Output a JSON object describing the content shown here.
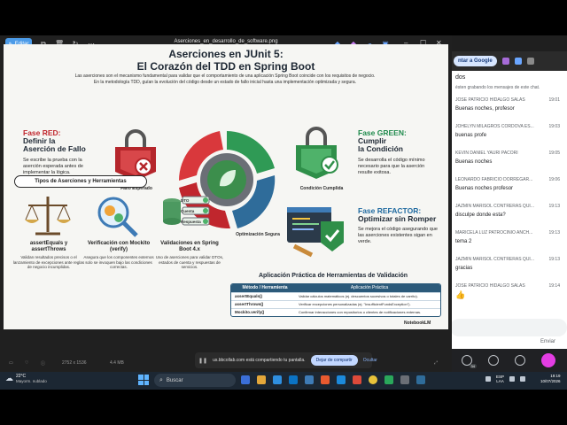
{
  "browser": {
    "google_pill": "ntar a Google",
    "chat_header": "dos"
  },
  "chat": {
    "note": "ésten grabando los mensajes de este chat.",
    "messages": [
      {
        "sender": "JOSE PATRICIO HIDALGO SALAS",
        "time": "19:01",
        "text": "Buenas noches, profesor"
      },
      {
        "sender": "JOHELYN MILAGROS CORDOVA ES...",
        "time": "19:03",
        "text": "buenas profe"
      },
      {
        "sender": "KEVIN DANIEL YAURI PACORI",
        "time": "19:05",
        "text": "Buenas noches"
      },
      {
        "sender": "LEONARDO FABRICIO DORREGAR...",
        "time": "19:06",
        "text": "Buenas noches profesor"
      },
      {
        "sender": "JAZMIN MARISOL CONTRERAS QUI...",
        "time": "19:13",
        "text": "disculpe donde esta?"
      },
      {
        "sender": "MARICELA LUZ PATROCINIO ANCH...",
        "time": "19:13",
        "text": "tema 2"
      },
      {
        "sender": "JAZMIN MARISOL CONTRERAS QUI...",
        "time": "19:13",
        "text": "gracias"
      },
      {
        "sender": "JOSE PATRICIO HIDALGO SALAS",
        "time": "19:14",
        "text": "👍"
      }
    ],
    "send_label": "Enviar",
    "badge": "34"
  },
  "viewer": {
    "edit_label": "Editar",
    "filename": "Aserciones_en_desarrollo_de_software.png",
    "dimensions": "2752 x 1536",
    "size": "4.4 MB"
  },
  "infographic": {
    "title_line1": "Aserciones en JUnit 5:",
    "title_line2": "El Corazón del TDD en Spring Boot",
    "intro_line1": "Las aserciones son el mecanismo fundamental para validar que el comportamiento de una aplicación Spring Boot coincide con los requisitos de negocio.",
    "intro_line2": "En la metodología TDD, guían la evolución del código desde un estado de fallo inicial hasta una implementación optimizada y segura.",
    "red": {
      "title1": "Fase RED:",
      "title2": "Definir la",
      "title3": "Aserción de Fallo",
      "desc": "Se escribe la prueba con la aserción esperada antes de implementar la lógica.",
      "caption": "Fallo Esperado"
    },
    "green": {
      "title1": "Fase GREEN:",
      "title2": "Cumplir",
      "title3": "la Condición",
      "desc": "Se desarrolla el código mínimo necesario para que la aserción resulte exitosa.",
      "caption": "Condición Cumplida"
    },
    "refactor": {
      "title1": "Fase REFACTOR:",
      "title2": "Optimizar sin Romper",
      "desc": "Se mejora el código asegurando que las aserciones existentes sigan en verde.",
      "caption": "Optimización Segura"
    },
    "tools_title": "Tipos de Aserciones y Herramientas",
    "tools": [
      {
        "name": "assertEquals y assertThrows",
        "desc": "Validan resultados precisos o el lanzamiento de excepciones ante reglas de negocio incumplidas."
      },
      {
        "name": "Verificación con Mockito (verify)",
        "desc": "Asegura que los componentes externos solo se invoquen bajo las condiciones correctas."
      },
      {
        "name": "Validaciones en Spring Boot 4.x",
        "desc": "Uso de aserciones para validar DTOs, estados de cuenta y respuestas de servicios."
      }
    ],
    "dto_labels": [
      "DTO",
      "Cuenta",
      "Respuesta"
    ],
    "table_title": "Aplicación Práctica de Herramientas de Validación",
    "table_headers": [
      "Método / Herramienta",
      "Aplicación Práctica"
    ],
    "table_rows": [
      [
        "assertEquals()",
        "Validar cálculos matemáticos (ej. descuentos sucesivos o totales de carrito)."
      ],
      [
        "assertThrows()",
        "Verificar excepciones personalizadas (ej. \"InsufficientFundsException\")."
      ],
      [
        "Mockito.verify()",
        "Confirmar interacciones con repositorios o clientes de notificaciones externas."
      ]
    ],
    "brand": "NotebookLM"
  },
  "share": {
    "text": "us.bbcollab.com está compartiendo tu pantalla.",
    "stop": "Dejar de compartir",
    "hide": "Ocultar"
  },
  "taskbar": {
    "temp": "22°C",
    "condition": "Mayorm. nublado",
    "search": "Buscar",
    "lang1": "ESP",
    "lang2": "LAA",
    "time": "19:19",
    "date": "10/07/2026"
  },
  "colors": {
    "accent": "#4c9be8",
    "red_phase": "#c0262d",
    "green_phase": "#1f8a4c",
    "refactor_phase": "#1d2733",
    "table_header": "#2c5a7a"
  }
}
